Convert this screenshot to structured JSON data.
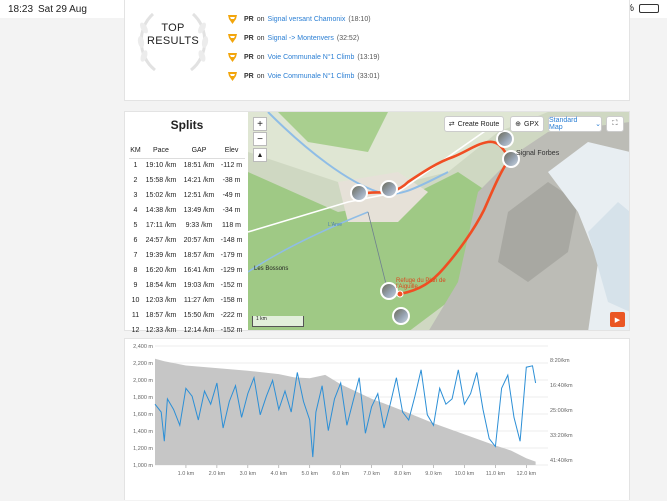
{
  "status_bar": {
    "time": "18:23",
    "date": "Sat 29 Aug",
    "battery": "38%"
  },
  "top_results": {
    "title_line1": "TOP",
    "title_line2": "RESULTS",
    "items": [
      {
        "label": "PR",
        "on": "on",
        "segment": "Signal versant Chamonix",
        "time": "(18:10)"
      },
      {
        "label": "PR",
        "on": "on",
        "segment": "Signal -> Montenvers",
        "time": "(32:52)"
      },
      {
        "label": "PR",
        "on": "on",
        "segment": "Voie Communale N°1 Climb",
        "time": "(13:19)"
      },
      {
        "label": "PR",
        "on": "on",
        "segment": "Voie Communale N°1 Climb",
        "time": "(33:01)"
      }
    ]
  },
  "splits": {
    "title": "Splits",
    "headers": [
      "KM",
      "Pace",
      "GAP",
      "Elev"
    ],
    "unit": "/km",
    "rows": [
      {
        "km": "1",
        "pace": "19:10",
        "gap": "18:51",
        "elev": "-112 m"
      },
      {
        "km": "2",
        "pace": "15:58",
        "gap": "14:21",
        "elev": "-38 m"
      },
      {
        "km": "3",
        "pace": "15:02",
        "gap": "12:51",
        "elev": "-49 m"
      },
      {
        "km": "4",
        "pace": "14:38",
        "gap": "13:49",
        "elev": "-34 m"
      },
      {
        "km": "5",
        "pace": "17:11",
        "gap": "9:33",
        "elev": "118 m"
      },
      {
        "km": "6",
        "pace": "24:57",
        "gap": "20:57",
        "elev": "-148 m"
      },
      {
        "km": "7",
        "pace": "19:39",
        "gap": "18:57",
        "elev": "-179 m"
      },
      {
        "km": "8",
        "pace": "16:20",
        "gap": "16:41",
        "elev": "-129 m"
      },
      {
        "km": "9",
        "pace": "18:54",
        "gap": "19:03",
        "elev": "-152 m"
      },
      {
        "km": "10",
        "pace": "12:03",
        "gap": "11:27",
        "elev": "-158 m"
      },
      {
        "km": "11",
        "pace": "18:57",
        "gap": "15:50",
        "elev": "-222 m"
      },
      {
        "km": "12",
        "pace": "12:33",
        "gap": "12:14",
        "elev": "-152 m"
      }
    ]
  },
  "map": {
    "create_route": "Create Route",
    "gpx": "GPX",
    "map_type": "Standard Map",
    "zoom_in": "+",
    "zoom_out": "−",
    "scale": "1 km",
    "labels": {
      "signal": "Signal Forbes",
      "refuge_line1": "Refuge du Plan de",
      "refuge_line2": "l'Aiguille",
      "bossons": "Les Bossons",
      "arve": "L'Arve"
    },
    "colors": {
      "route": "#f04e23",
      "forest": "#9fc985",
      "rock": "#bcbcb6",
      "glacier": "#e8eef2",
      "water": "#8fbde6"
    }
  },
  "chart_data": {
    "type": "area",
    "x_unit": "km",
    "x_ticks": [
      "1.0 km",
      "2.0 km",
      "3.0 km",
      "4.0 km",
      "5.0 km",
      "6.0 km",
      "7.0 km",
      "8.0 km",
      "9.0 km",
      "10.0 km",
      "11.0 km",
      "12.0 km"
    ],
    "y_ticks": [
      "2,400 m",
      "2,200 m",
      "2,000 m",
      "1,800 m",
      "1,600 m",
      "1,400 m",
      "1,200 m",
      "1,000 m"
    ],
    "y2_ticks": [
      "8:20/km",
      "16:40/km",
      "25:00/km",
      "33:20/km",
      "41:40/km"
    ],
    "ylim": [
      1000,
      2400
    ],
    "xlim": [
      0,
      12.7
    ],
    "series": [
      {
        "kind": "elevation",
        "color": "#c6c6c6",
        "x": [
          0,
          0.3,
          1,
          2,
          3,
          4,
          4.5,
          5,
          5.5,
          6,
          7,
          8,
          9,
          10,
          11,
          11.5,
          12,
          12.3
        ],
        "y": [
          2250,
          2220,
          2170,
          2140,
          2110,
          2070,
          2030,
          2020,
          2060,
          1950,
          1780,
          1640,
          1490,
          1360,
          1230,
          1170,
          1080,
          1040
        ]
      },
      {
        "kind": "pace",
        "color": "#2c8fd6",
        "x": [
          0.0,
          0.2,
          0.3,
          0.4,
          0.6,
          0.8,
          1.0,
          1.2,
          1.4,
          1.6,
          1.8,
          2.0,
          2.2,
          2.4,
          2.6,
          2.8,
          3.0,
          3.2,
          3.4,
          3.6,
          3.8,
          4.0,
          4.2,
          4.4,
          4.6,
          4.8,
          5.0,
          5.1,
          5.2,
          5.4,
          5.6,
          5.8,
          6.0,
          6.2,
          6.4,
          6.6,
          6.8,
          7.0,
          7.2,
          7.4,
          7.6,
          7.8,
          8.0,
          8.2,
          8.4,
          8.6,
          8.8,
          9.0,
          9.2,
          9.4,
          9.6,
          9.8,
          10.0,
          10.2,
          10.4,
          10.6,
          10.8,
          11.0,
          11.2,
          11.4,
          11.6,
          11.8,
          12.0,
          12.2,
          12.3
        ],
        "y": [
          22.0,
          25.0,
          36.0,
          20.0,
          24.0,
          30.0,
          16.0,
          19.0,
          28.0,
          17.0,
          22.0,
          14.0,
          31.0,
          21.0,
          15.0,
          27.0,
          18.0,
          12.0,
          26.0,
          19.0,
          13.0,
          24.0,
          17.0,
          25.0,
          10.0,
          21.0,
          28.0,
          42.0,
          25.0,
          15.0,
          32.0,
          20.0,
          14.0,
          30.0,
          21.0,
          12.0,
          33.0,
          23.0,
          18.0,
          31.0,
          22.0,
          12.0,
          25.0,
          28.0,
          19.0,
          9.0,
          26.0,
          30.0,
          16.0,
          22.0,
          20.0,
          9.0,
          22.0,
          18.0,
          10.0,
          24.0,
          35.0,
          38.0,
          16.0,
          11.0,
          27.0,
          36.0,
          8.0,
          7.5,
          14.0
        ]
      }
    ]
  }
}
